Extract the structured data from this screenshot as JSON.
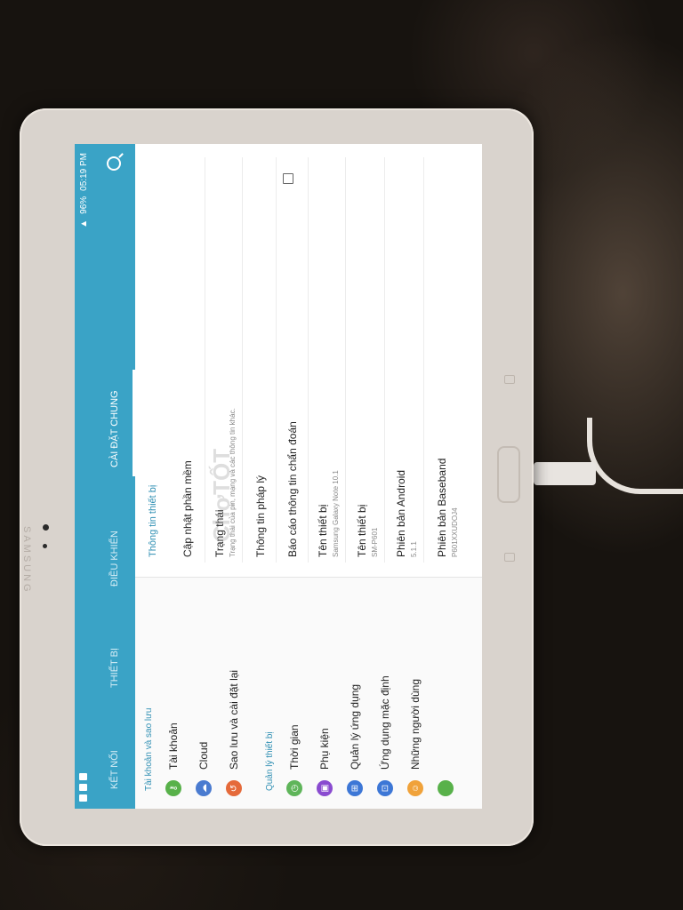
{
  "device": {
    "brand": "SAMSUNG"
  },
  "status_bar": {
    "battery": "96%",
    "time": "05:19 PM"
  },
  "tabs": [
    {
      "label": "KẾT NỐI"
    },
    {
      "label": "THIẾT BỊ"
    },
    {
      "label": "ĐIỀU KHIỂN"
    },
    {
      "label": "CÀI ĐẶT CHUNG"
    }
  ],
  "active_tab_index": 3,
  "left_menu": {
    "section1": "Tài khoản và sao lưu",
    "items1": [
      {
        "label": "Tài khoản",
        "icon": "key-icon",
        "color": "#58b14a"
      },
      {
        "label": "Cloud",
        "icon": "cloud-icon",
        "color": "#4a7bd0"
      },
      {
        "label": "Sao lưu và cài đặt lại",
        "icon": "reset-icon",
        "color": "#e56a3a"
      }
    ],
    "section2": "Quản lý thiết bị",
    "items2": [
      {
        "label": "Thời gian",
        "icon": "clock-icon",
        "color": "#5fb55a"
      },
      {
        "label": "Phụ kiện",
        "icon": "accessory-icon",
        "color": "#8a4bd0"
      },
      {
        "label": "Quản lý ứng dụng",
        "icon": "apps-icon",
        "color": "#3d77d6"
      },
      {
        "label": "Ứng dụng mặc định",
        "icon": "default-apps-icon",
        "color": "#3d77d6"
      },
      {
        "label": "Những người dùng",
        "icon": "users-icon",
        "color": "#f0a23a"
      }
    ]
  },
  "right_pane": {
    "header": "Thông tin thiết bị",
    "items": [
      {
        "title": "Cập nhật phần mềm",
        "subtitle": ""
      },
      {
        "title": "Trạng thái",
        "subtitle": "Trạng thái của pin, mạng và các thông tin khác."
      },
      {
        "title": "Thông tin pháp lý",
        "subtitle": ""
      },
      {
        "title": "Báo cáo thông tin chẩn đoán",
        "subtitle": ""
      },
      {
        "title": "Tên thiết bị",
        "subtitle": "Samsung Galaxy Note 10.1"
      },
      {
        "title": "Tên thiết bị",
        "subtitle": "SM-P601"
      },
      {
        "title": "Phiên bản Android",
        "subtitle": "5.1.1"
      },
      {
        "title": "Phiên bản Baseband",
        "subtitle": "P601XXUDOJ4"
      }
    ]
  },
  "watermark": "ChợTỐT",
  "colors": {
    "accent": "#3aa3c6",
    "section_text": "#2f8fb3"
  }
}
